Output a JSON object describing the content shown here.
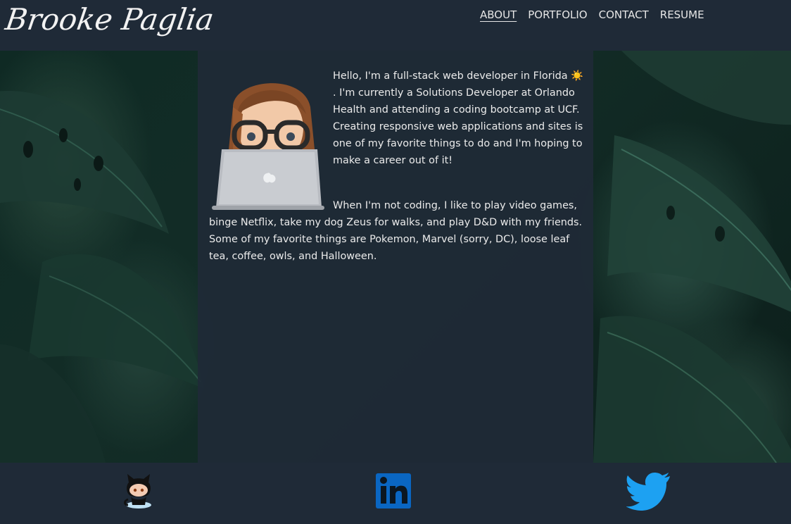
{
  "header": {
    "brand": "Brooke Paglia",
    "nav": [
      {
        "label": "ABOUT",
        "active": true
      },
      {
        "label": "PORTFOLIO",
        "active": false
      },
      {
        "label": "CONTACT",
        "active": false
      },
      {
        "label": "RESUME",
        "active": false
      }
    ]
  },
  "about": {
    "avatar_icon": "memoji-laptop-avatar",
    "paragraph1_before_emoji": "Hello, I'm a full-stack web developer in Florida ",
    "emoji": "☀️",
    "paragraph1_after_emoji": ". I'm currently a Solutions Developer at Orlando Health and attending a coding bootcamp at UCF. Creating responsive web applications and sites is one of my favorite things to do and I'm hoping to make a career out of it!",
    "paragraph2": "When I'm not coding, I like to play video games, binge Netflix, take my dog Zeus for walks, and play D&D with my friends. Some of my favorite things are Pokemon, Marvel (sorry, DC), loose leaf tea, coffee, owls, and Halloween."
  },
  "footer": {
    "links": [
      {
        "icon": "github-octocat-icon"
      },
      {
        "icon": "linkedin-icon"
      },
      {
        "icon": "twitter-icon"
      }
    ]
  },
  "colors": {
    "header_bg": "#1f2a37",
    "panel_bg": "#1f2a37",
    "linkedin_blue": "#0a66c2",
    "twitter_blue": "#1da1f2"
  }
}
